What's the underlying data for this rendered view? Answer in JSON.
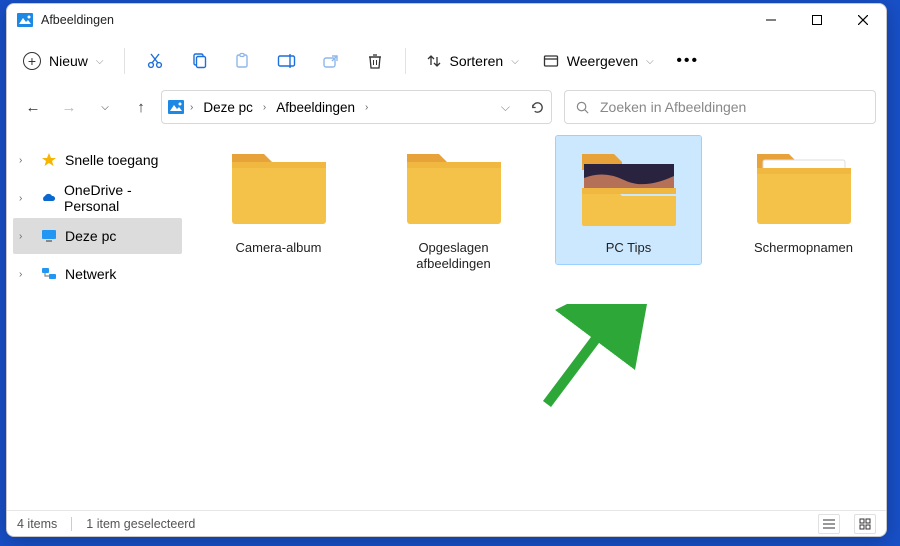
{
  "title": "Afbeeldingen",
  "toolbar": {
    "new_label": "Nieuw",
    "sort_label": "Sorteren",
    "view_label": "Weergeven"
  },
  "breadcrumbs": [
    "Deze pc",
    "Afbeeldingen"
  ],
  "search": {
    "placeholder": "Zoeken in Afbeeldingen"
  },
  "sidebar": {
    "items": [
      {
        "label": "Snelle toegang"
      },
      {
        "label": "OneDrive - Personal"
      },
      {
        "label": "Deze pc"
      },
      {
        "label": "Netwerk"
      }
    ]
  },
  "folders": [
    {
      "label": "Camera-album"
    },
    {
      "label": "Opgeslagen afbeeldingen"
    },
    {
      "label": "PC Tips"
    },
    {
      "label": "Schermopnamen"
    }
  ],
  "status": {
    "count": "4 items",
    "selection": "1 item geselecteerd"
  }
}
